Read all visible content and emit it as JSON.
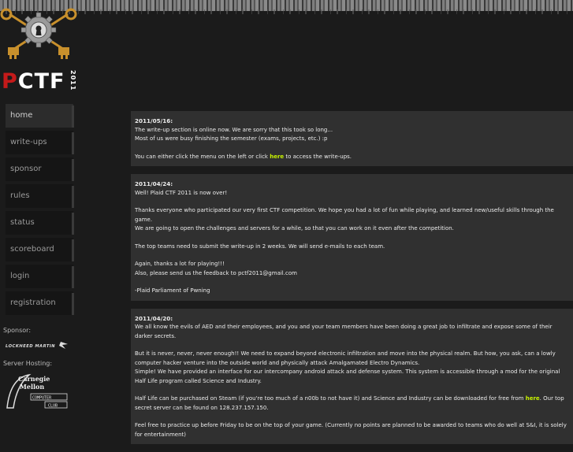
{
  "logo": {
    "text_p": "P",
    "text_rest": "CTF",
    "year": "2011"
  },
  "nav": {
    "items": [
      {
        "label": "home"
      },
      {
        "label": "write-ups"
      },
      {
        "label": "sponsor"
      },
      {
        "label": "rules"
      },
      {
        "label": "status"
      },
      {
        "label": "scoreboard"
      },
      {
        "label": "login"
      },
      {
        "label": "registration"
      }
    ]
  },
  "sidebar": {
    "sponsor_label": "Sponsor:",
    "sponsor_name": "LOCKHEED MARTIN",
    "hosting_label": "Server Hosting:",
    "hosting_name_1": "Carnegie",
    "hosting_name_2": "Mellon",
    "hosting_club_1": "COMPUTER",
    "hosting_club_2": "CLUB"
  },
  "colors": {
    "accent_link": "#c6f000",
    "brand_red": "#c41a1a",
    "post_bg": "#303030"
  },
  "posts": [
    {
      "date": "2011/05/16:",
      "p1_l1": "The write-up section is online now. We are sorry that this took so long...",
      "p1_l2": "Most of us were busy finishing the semester (exams, projects, etc.) :p",
      "p2_pre": "You can either click the menu on the left or click ",
      "p2_link": "here",
      "p2_post": " to access the write-ups."
    },
    {
      "date": "2011/04/24:",
      "p1": "Well! Plaid CTF 2011 is now over!",
      "p2_l1": "Thanks everyone who participated our very first CTF competition. We hope you had a lot of fun while playing, and learned new/useful skills through the game.",
      "p2_l2": "We are going to open the challenges and servers for a while, so that you can work on it even after the competition.",
      "p3": "The top teams need to submit the write-up in 2 weeks. We will send e-mails to each team.",
      "p4_l1": "Again, thanks a lot for playing!!!",
      "p4_l2": "Also, please send us the feedback to pctf2011@gmail.com",
      "p5": "-Plaid Parliament of Pwning"
    },
    {
      "date": "2011/04/20:",
      "p1": "We all know the evils of AED and their employees, and you and your team members have been doing a great job to infiltrate and expose some of their darker secrets.",
      "p2_l1": "But it is never, never, never enough!! We need to expand beyond electronic infiltration and move into the physical realm. But how, you ask, can a lowly computer hacker venture into the outside world and physically attack Amalgamated Electro Dynamics.",
      "p2_l2": "Simple! We have provided an interface for our intercompany android attack and defense system. This system is accessible through a mod for the original Half Life program called Science and Industry.",
      "p3_pre": "Half Life can be purchased on Steam (if you're too much of a n00b to not have it) and Science and Industry can be downloaded for free from ",
      "p3_link": "here",
      "p3_post": ". Our top secret server can be found on 128.237.157.150.",
      "p4": "Feel free to practice up before Friday to be on the top of your game. (Currently no points are planned to be awarded to teams who do well at S&I, it is solely for entertainment)"
    }
  ]
}
